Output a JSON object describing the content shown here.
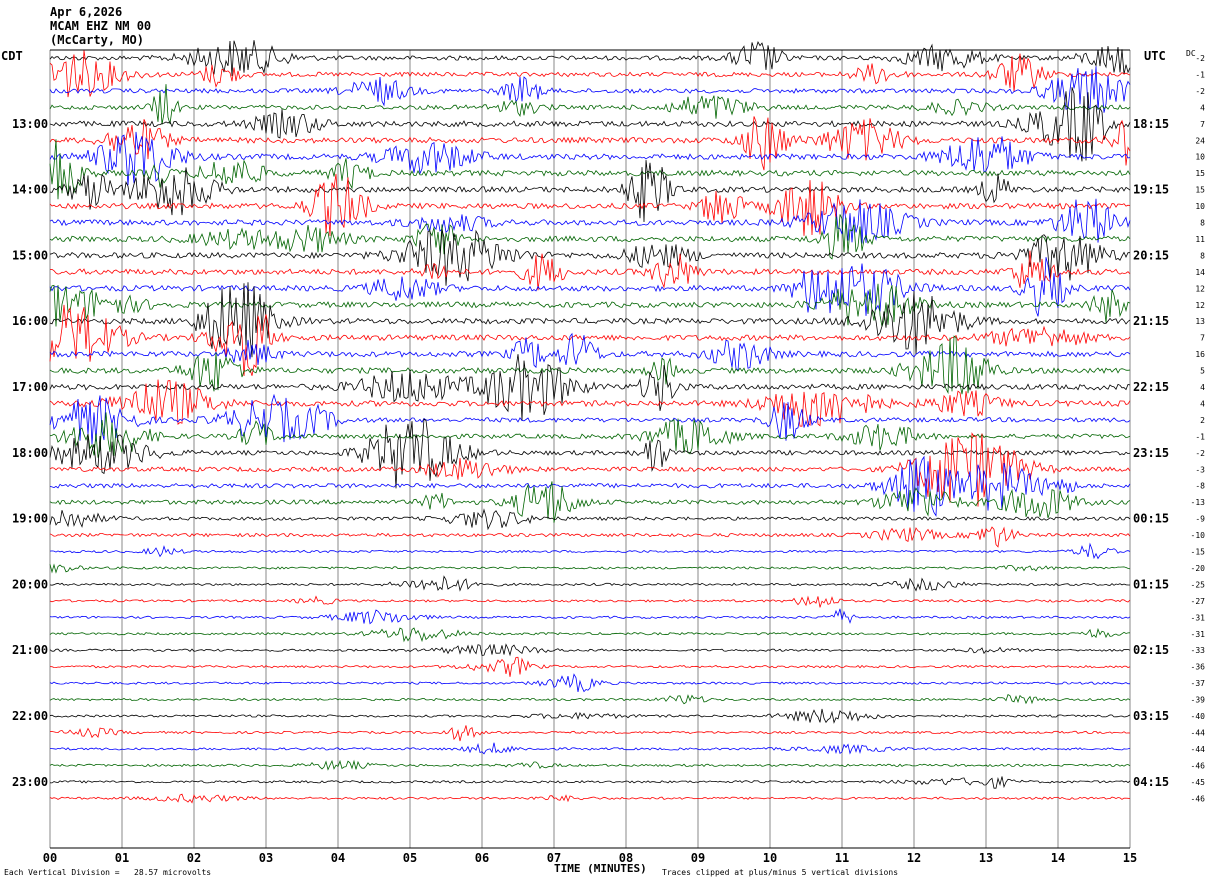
{
  "header": {
    "date": "Apr 6,2026",
    "station": "MCAM EHZ NM 00",
    "location": "(McCarty, MO)",
    "left_tz": "CDT",
    "right_tz": "UTC",
    "dc_label": "DC"
  },
  "footer": {
    "vertical_division": "Each Vertical Division =   28.57 microvolts",
    "clip_note": "Traces clipped at plus/minus 5 vertical divisions"
  },
  "colors": {
    "black": "#000000",
    "red": "#ff0000",
    "blue": "#0000ff",
    "green": "#006400",
    "grid": "#888888"
  },
  "chart_data": {
    "type": "line",
    "title": "",
    "xlabel": "TIME (MINUTES)",
    "ylabel": "",
    "xlim": [
      0,
      15
    ],
    "x_ticks": [
      "00",
      "01",
      "02",
      "03",
      "04",
      "05",
      "06",
      "07",
      "08",
      "09",
      "10",
      "11",
      "12",
      "13",
      "14",
      "15"
    ],
    "trace_minutes": 15,
    "trace_colors_cycle": [
      "black",
      "red",
      "blue",
      "green"
    ],
    "left_hour_labels": [
      "13:00",
      "14:00",
      "15:00",
      "16:00",
      "17:00",
      "18:00",
      "19:00",
      "20:00",
      "21:00",
      "22:00",
      "23:00"
    ],
    "right_hour_labels": [
      "18:15",
      "19:15",
      "20:15",
      "21:15",
      "22:15",
      "23:15",
      "00:15",
      "01:15",
      "02:15",
      "03:15",
      "04:15"
    ],
    "dc_offsets": [
      -2,
      -1,
      -2,
      4,
      7,
      24,
      10,
      15,
      15,
      10,
      8,
      11,
      8,
      14,
      12,
      12,
      13,
      7,
      16,
      5,
      4,
      4,
      2,
      -1,
      -2,
      -3,
      -8,
      -13,
      -9,
      -10,
      -15,
      -20,
      -25,
      -27,
      -31,
      -31,
      -33,
      -36,
      -37,
      -39,
      -40,
      -44,
      -44,
      -46,
      -45,
      -46
    ],
    "activity_level": [
      3,
      3,
      3,
      3,
      4,
      4,
      4,
      4,
      4,
      4,
      4,
      4,
      4,
      4,
      4,
      4,
      4,
      4,
      4,
      4,
      4,
      4,
      3,
      3,
      3,
      3,
      3,
      3,
      2,
      2,
      1,
      1,
      1,
      1,
      1,
      1,
      1,
      1,
      1,
      1,
      1,
      1,
      1,
      1,
      1,
      1
    ]
  }
}
